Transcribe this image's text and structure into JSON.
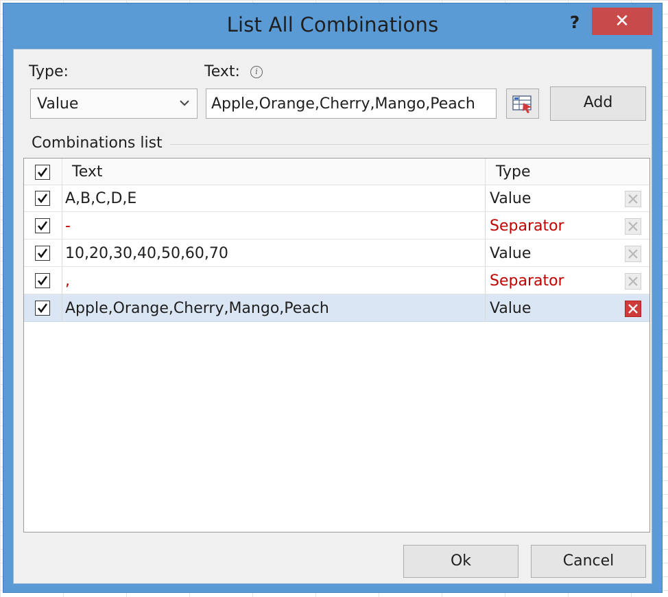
{
  "window": {
    "title": "List All Combinations",
    "help_label": "?",
    "close_label": "✕"
  },
  "form": {
    "type_label": "Type:",
    "type_value": "Value",
    "text_label": "Text:",
    "text_value": "Apple,Orange,Cherry,Mango,Peach",
    "add_label": "Add"
  },
  "combinations": {
    "group_title": "Combinations list",
    "columns": {
      "text": "Text",
      "type": "Type"
    },
    "rows": [
      {
        "text": "A,B,C,D,E",
        "type": "Value"
      },
      {
        "text": "-",
        "type": "Separator"
      },
      {
        "text": "10,20,30,40,50,60,70",
        "type": "Value"
      },
      {
        "text": ",",
        "type": "Separator"
      },
      {
        "text": "Apple,Orange,Cherry,Mango,Peach",
        "type": "Value"
      }
    ]
  },
  "footer": {
    "ok_label": "Ok",
    "cancel_label": "Cancel"
  },
  "colors": {
    "separator_text": "#c00000",
    "close_button": "#c94a4a",
    "selected_row": "#dbe6f4",
    "frame": "#5b9bd5"
  },
  "icons": {
    "info": "info-icon",
    "range": "range-select-icon",
    "checkbox": "checkmark-icon",
    "delete": "delete-x-icon",
    "dropdown": "chevron-down-icon"
  }
}
